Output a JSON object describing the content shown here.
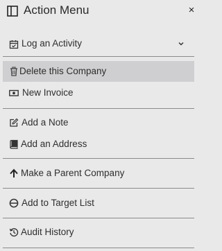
{
  "header": {
    "title": "Action Menu",
    "close_label": "×"
  },
  "menu": {
    "log_activity": "Log an Activity",
    "delete_company": "Delete this Company",
    "new_invoice": "New Invoice",
    "add_note": "Add a Note",
    "add_address": "Add an Address",
    "make_parent": "Make a Parent Company",
    "add_target_list": "Add to Target List",
    "audit_history": "Audit History"
  },
  "icons": {
    "panel": "panel-icon",
    "close": "close-icon",
    "calendar": "calendar-icon",
    "chevron": "chevron-down-icon",
    "trash": "trash-icon",
    "money": "money-icon",
    "edit": "edit-icon",
    "book": "book-icon",
    "arrow_up": "arrow-up-icon",
    "target": "target-icon",
    "history": "history-icon"
  },
  "colors": {
    "background": "#e9e9ea",
    "active_row": "#cfcfd1",
    "separator": "#8a8a8a"
  }
}
